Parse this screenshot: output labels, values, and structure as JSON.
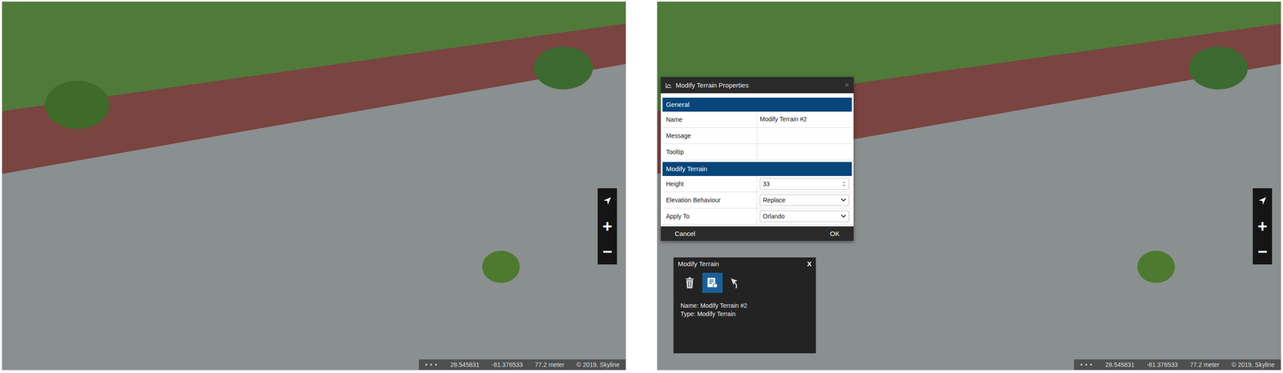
{
  "views": [
    {
      "photo": true,
      "map_controls": [
        {
          "kind": "select"
        },
        {
          "kind": "text",
          "label": "+"
        },
        {
          "kind": "text",
          "label": "−"
        }
      ],
      "status_bar": {
        "latitude": "28.545831",
        "longitude": "-81.376533",
        "altitude": "77.2 meter",
        "copyright": "© 2019, Skyline"
      }
    },
    {
      "photo": true,
      "map_controls": [
        {
          "kind": "select"
        },
        {
          "kind": "text",
          "label": "+"
        },
        {
          "kind": "text",
          "label": "−"
        }
      ],
      "status_bar": {
        "latitude": "28.545831",
        "longitude": "-81.376533",
        "altitude": "77.2 meter",
        "copyright": "© 2019, Skyline"
      },
      "dialog": {
        "title": "Modify Terrain Properties",
        "close": "×",
        "sections": [
          {
            "title": "General",
            "rows": [
              {
                "label": "Name",
                "value": "Modify Terrain #2",
                "kind": "text"
              },
              {
                "label": "Message",
                "value": "",
                "kind": "text"
              },
              {
                "label": "Tooltip",
                "value": "",
                "kind": "text"
              }
            ]
          },
          {
            "title": "Modify Terrain",
            "rows": [
              {
                "label": "Height",
                "value": "33",
                "kind": "spinner"
              },
              {
                "label": "Elevation Behaviour",
                "value": "Replace",
                "kind": "select"
              },
              {
                "label": "Apply To",
                "value": "Orlando",
                "kind": "select"
              }
            ]
          }
        ],
        "buttons": [
          "Cancel",
          "OK"
        ]
      },
      "info_panel": {
        "title": "Modify Terrain",
        "close": "X",
        "tools": [
          {
            "kind": "delete",
            "selected": false
          },
          {
            "kind": "properties",
            "selected": true
          },
          {
            "kind": "flyto",
            "selected": false
          }
        ],
        "lines": [
          {
            "label": "Name:",
            "value": "Modify Terrain #2"
          },
          {
            "label": "Type:",
            "value": "Modify Terrain"
          }
        ]
      }
    }
  ]
}
